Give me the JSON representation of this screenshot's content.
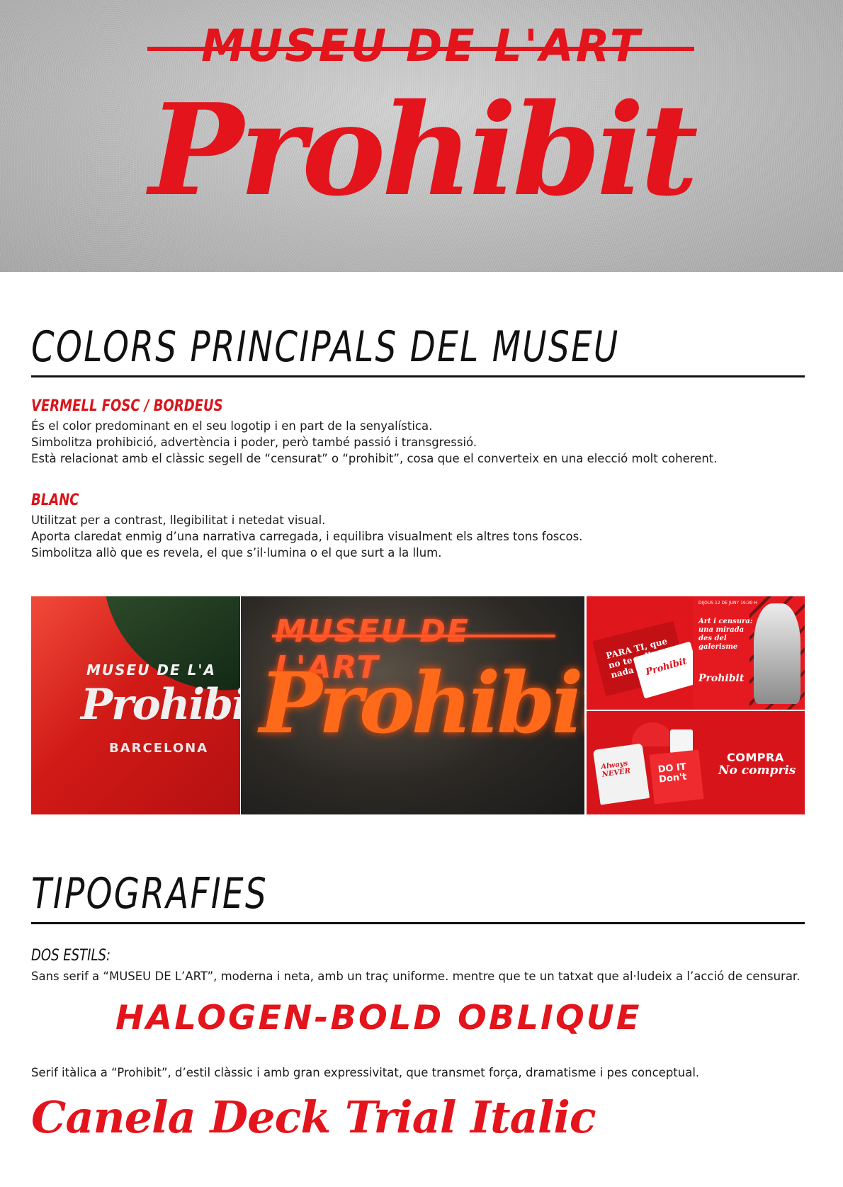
{
  "hero": {
    "top_line": "MUSEU DE L'ART",
    "wordmark": "Prohibit"
  },
  "colors_section": {
    "heading": "COLORS PRINCIPALS DEL MUSEU",
    "blocks": [
      {
        "title": "VERMELL FOSC / BORDEUS",
        "lines": [
          "És el color predominant en el seu logotip i en part de la senyalística.",
          "Simbolitza prohibició, advertència i poder, però també passió i transgressió.",
          "Està relacionat amb el clàssic segell de “censurat” o “prohibit”, cosa que el converteix en una elecció molt coherent."
        ]
      },
      {
        "title": "BLANC",
        "lines": [
          "Utilitzat per a contrast, llegibilitat i netedat visual.",
          "Aporta claredat enmig d’una narrativa carregada, i equilibra visualment els altres tons foscos.",
          "Simbolitza allò que es revela, el que s’il·lumina o el que surt a la llum."
        ]
      }
    ]
  },
  "gallery": {
    "tile1": {
      "museu": "MUSEU DE L'A",
      "wordmark": "Prohibi",
      "city": "BARCELONA"
    },
    "tile2": {
      "museu": "MUSEU DE L'ART",
      "wordmark": "Prohibit"
    },
    "tile3": {
      "card_text": "PARA TI, que no te callas nada",
      "card_logo": "Prohibit",
      "poster_date": "DIJOUS 12 DE JUNY 19:30 H",
      "poster_title": "Art i censura: una mirada des del galerisme",
      "poster_logo": "Prohibit"
    },
    "tile4": {
      "shirt_text": "Always NEVER",
      "bag_text": "DO IT Don't",
      "compra": "COMPRA",
      "no_compris": "No compris"
    }
  },
  "type_section": {
    "heading": "TIPOGRAFIES",
    "subheading": "DOS ESTILS:",
    "sans_description": "Sans serif a “MUSEU DE L’ART”, moderna i neta, amb un traç uniforme. mentre que te un tatxat que al·ludeix a l’acció de censurar.",
    "sans_specimen": "HALOGEN-BOLD OBLIQUE",
    "serif_description": "Serif itàlica a “Prohibit”, d’estil clàssic i amb gran expressivitat, que transmet força, dramatisme i pes conceptual.",
    "serif_specimen": "Canela Deck Trial Italic"
  },
  "palette": {
    "brand_red": "#e3141b",
    "white": "#ffffff"
  }
}
